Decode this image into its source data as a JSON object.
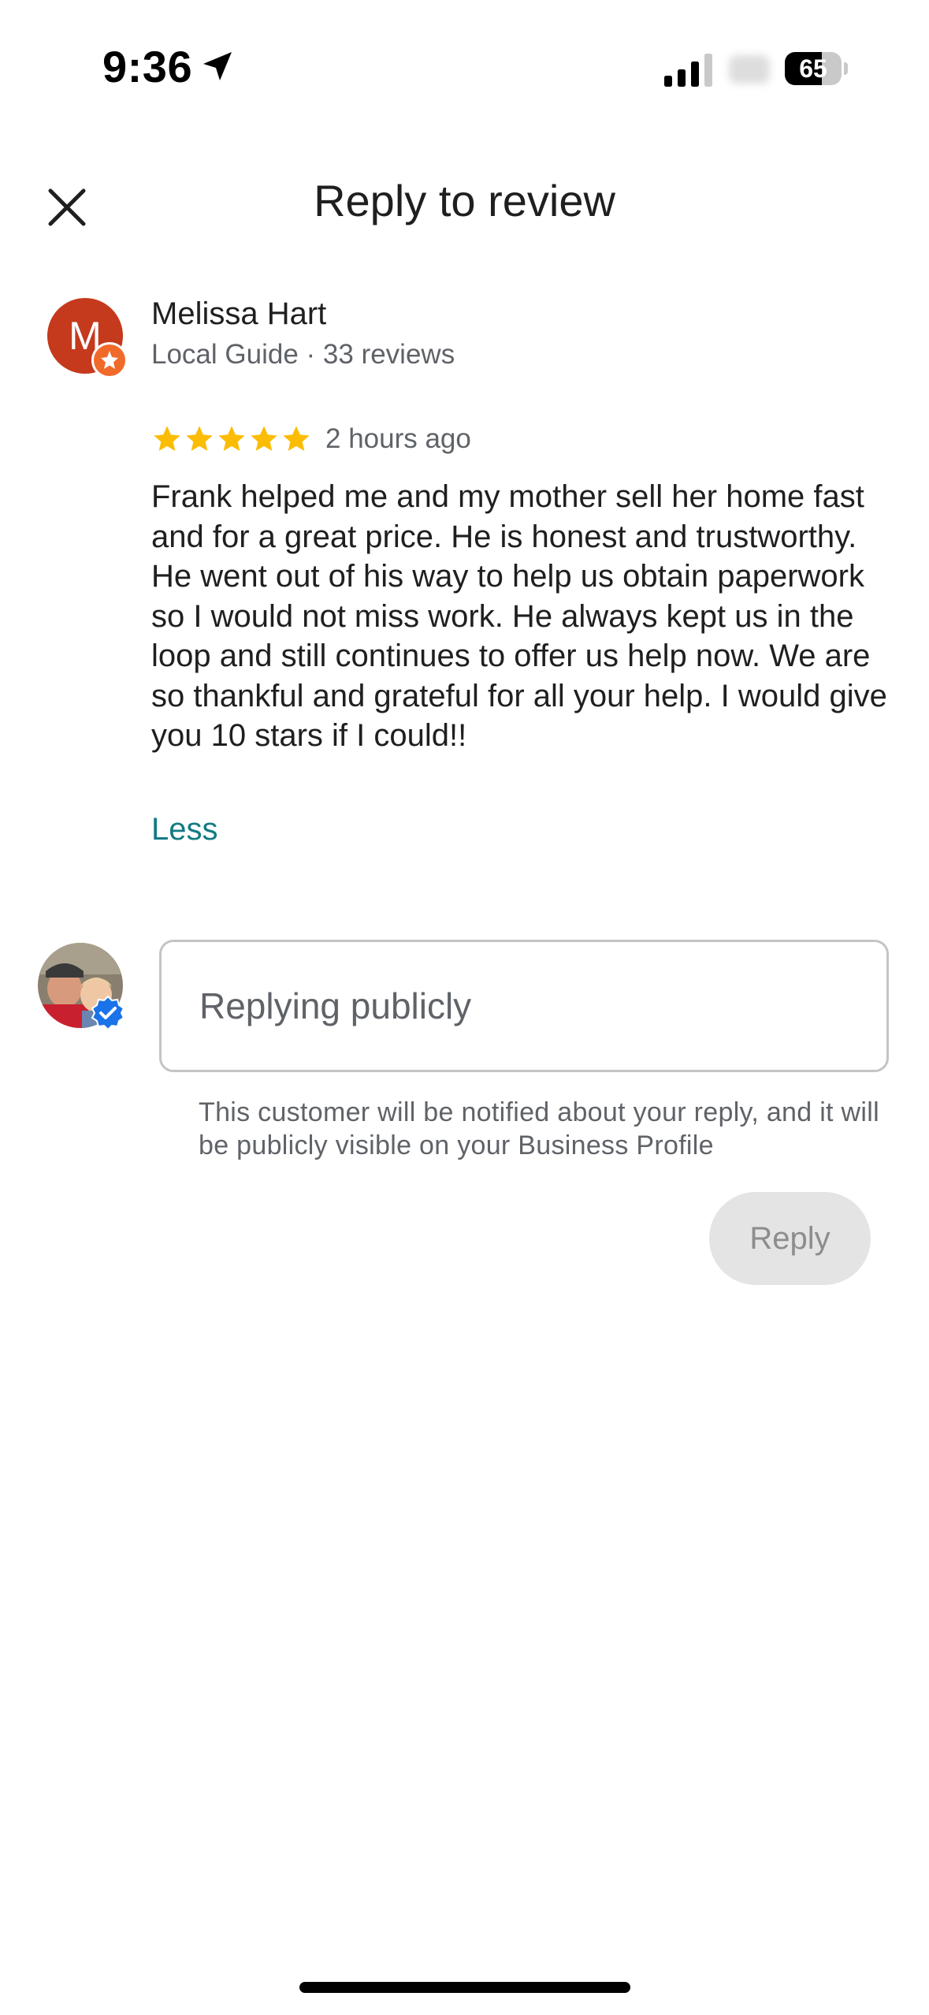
{
  "status_bar": {
    "time": "9:36",
    "battery_level": "65",
    "battery_fraction": 0.65
  },
  "header": {
    "title": "Reply to review"
  },
  "review": {
    "avatar_initial": "M",
    "avatar_color": "#c5391c",
    "author_name": "Melissa Hart",
    "author_meta": "Local Guide · 33 reviews",
    "rating": 5,
    "time_ago": "2 hours ago",
    "text": "Frank helped me and my mother sell her home fast and for a great price. He is honest and trustworthy. He went out of his way to help us obtain paperwork so I would not miss work. He always kept us in the loop and still continues to offer us help now. We are so thankful and grateful for all your help. I would give you 10 stars if I could!!",
    "collapse_label": "Less"
  },
  "reply": {
    "placeholder": "Replying publicly",
    "value": "",
    "notice": "This customer will be notified about your reply, and it will be publicly visible on your Business Profile",
    "button_label": "Reply"
  },
  "colors": {
    "accent_link": "#137a83",
    "star": "#fbbc04",
    "verified": "#1a73e8",
    "disabled_button_bg": "#e4e4e4"
  }
}
